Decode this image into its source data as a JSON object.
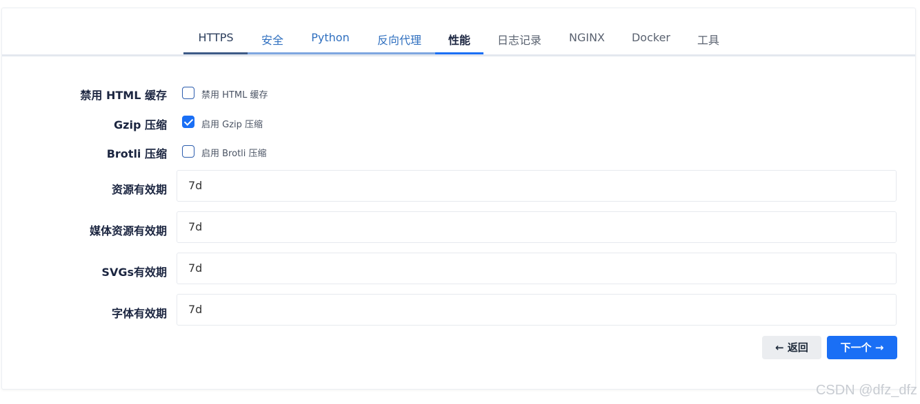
{
  "tabs": [
    {
      "label": "HTTPS",
      "state": "first"
    },
    {
      "label": "安全",
      "state": "done"
    },
    {
      "label": "Python",
      "state": "done"
    },
    {
      "label": "反向代理",
      "state": "done"
    },
    {
      "label": "性能",
      "state": "active"
    },
    {
      "label": "日志记录",
      "state": "todo"
    },
    {
      "label": "NGINX",
      "state": "todo"
    },
    {
      "label": "Docker",
      "state": "todo"
    },
    {
      "label": "工具",
      "state": "todo"
    }
  ],
  "colors": {
    "accent": "#1a6ff5",
    "tab_done_bar": "#7ea6e0",
    "tab_first_bar": "#3d5a87"
  },
  "form": {
    "disable_html_cache": {
      "label": "禁用 HTML 缓存",
      "checkbox_text": "禁用 HTML 缓存",
      "checked": false
    },
    "gzip": {
      "label": "Gzip 压缩",
      "checkbox_text": "启用 Gzip 压缩",
      "checked": true
    },
    "brotli": {
      "label": "Brotli 压缩",
      "checkbox_text": "启用 Brotli 压缩",
      "checked": false
    },
    "asset_expiry": {
      "label": "资源有效期",
      "value": "7d"
    },
    "media_expiry": {
      "label": "媒体资源有效期",
      "value": "7d"
    },
    "svg_expiry": {
      "label": "SVGs有效期",
      "value": "7d"
    },
    "font_expiry": {
      "label": "字体有效期",
      "value": "7d"
    }
  },
  "buttons": {
    "back": "← 返回",
    "next": "下一个 →"
  },
  "watermark": "CSDN @dfz_dfz"
}
